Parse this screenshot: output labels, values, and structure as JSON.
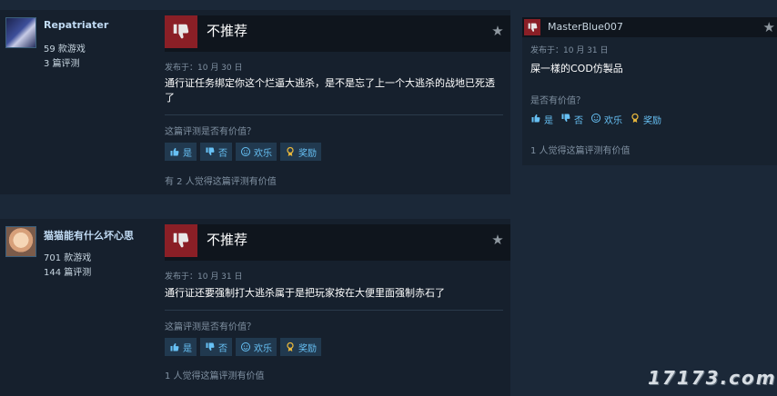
{
  "reviews": [
    {
      "username": "Repatriater",
      "games": "59 款游戏",
      "reviews_count": "3 篇评测",
      "verdict": "不推荐",
      "date": "发布于：10 月 30 日",
      "text": "通行证任务绑定你这个烂逼大逃杀，是不是忘了上一个大逃杀的战地已死透了",
      "helpful_question": "这篇评测是否有价值？",
      "buttons": {
        "yes": "是",
        "no": "否",
        "funny": "欢乐",
        "award": "奖励"
      },
      "found_helpful": "有 2 人觉得这篇评测有价值"
    },
    {
      "username": "猫猫能有什么坏心思",
      "games": "701 款游戏",
      "reviews_count": "144 篇评测",
      "verdict": "不推荐",
      "date": "发布于：10 月 31 日",
      "text": "通行证还要强制打大逃杀属于是把玩家按在大便里面强制赤石了",
      "helpful_question": "这篇评测是否有价值？",
      "buttons": {
        "yes": "是",
        "no": "否",
        "funny": "欢乐",
        "award": "奖励"
      },
      "found_helpful": "1 人觉得这篇评测有价值"
    }
  ],
  "side_review": {
    "username": "MasterBlue007",
    "date": "发布于：10 月 31 日",
    "text": "屎一樣的COD仿製品",
    "helpful_question": "是否有价值？",
    "buttons": {
      "yes": "是",
      "no": "否",
      "funny": "欢乐",
      "award": "奖励"
    },
    "found_helpful": "1 人觉得这篇评测有价值"
  },
  "watermark": "17173.com",
  "colors": {
    "background": "#1b2838",
    "thumb_down": "#8a1f26",
    "button_text": "#67c1f5",
    "award": "#e5b53c"
  }
}
